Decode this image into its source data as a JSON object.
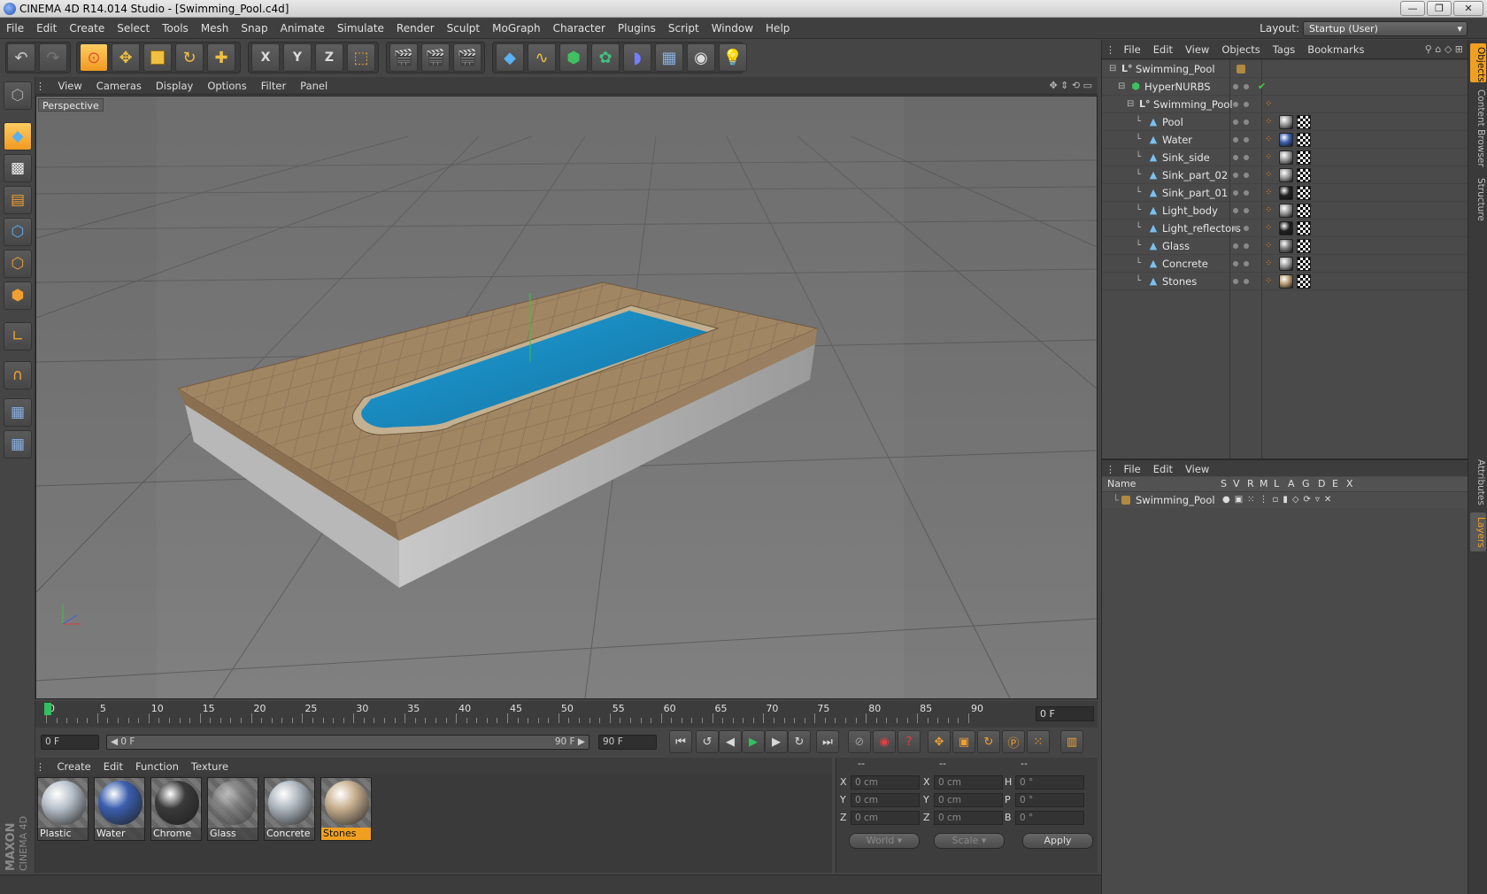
{
  "window": {
    "title": "CINEMA 4D R14.014 Studio - [Swimming_Pool.c4d]",
    "min_glyph": "—",
    "max_glyph": "❐",
    "close_glyph": "✕"
  },
  "menubar": {
    "items": [
      "File",
      "Edit",
      "Create",
      "Select",
      "Tools",
      "Mesh",
      "Snap",
      "Animate",
      "Simulate",
      "Render",
      "Sculpt",
      "MoGraph",
      "Character",
      "Plugins",
      "Script",
      "Window",
      "Help"
    ],
    "layout_label": "Layout:",
    "layout_value": "Startup (User)"
  },
  "toolbar": {
    "undo_glyph": "↶",
    "redo_glyph": "↷",
    "axis_x": "X",
    "axis_y": "Y",
    "axis_z": "Z"
  },
  "viewport": {
    "menu": [
      "View",
      "Cameras",
      "Display",
      "Options",
      "Filter",
      "Panel"
    ],
    "label": "Perspective"
  },
  "timeline": {
    "ticks": [
      "0",
      "5",
      "10",
      "15",
      "20",
      "25",
      "30",
      "35",
      "40",
      "45",
      "50",
      "55",
      "60",
      "65",
      "70",
      "75",
      "80",
      "85",
      "90"
    ],
    "current_frame": "0 F"
  },
  "transport": {
    "start_field": "0 F",
    "range_start": "◀ 0 F",
    "range_end": "90 F ▶",
    "end_field": "90 F"
  },
  "materials": {
    "menu": [
      "Create",
      "Edit",
      "Function",
      "Texture"
    ],
    "items": [
      {
        "name": "Plastic",
        "color": "#b9c2cc"
      },
      {
        "name": "Water",
        "color": "#3b5fae"
      },
      {
        "name": "Chrome",
        "color": "#3a3a3a"
      },
      {
        "name": "Glass",
        "color": "#8a8a8a"
      },
      {
        "name": "Concrete",
        "color": "#b0b8c0"
      },
      {
        "name": "Stones",
        "color": "#c8b090"
      }
    ],
    "selected": "Stones"
  },
  "coordinates": {
    "header": [
      "--",
      "--",
      "--"
    ],
    "rows": [
      {
        "l1": "X",
        "v1": "0 cm",
        "l2": "X",
        "v2": "0 cm",
        "l3": "H",
        "v3": "0 °"
      },
      {
        "l1": "Y",
        "v1": "0 cm",
        "l2": "Y",
        "v2": "0 cm",
        "l3": "P",
        "v3": "0 °"
      },
      {
        "l1": "Z",
        "v1": "0 cm",
        "l2": "Z",
        "v2": "0 cm",
        "l3": "B",
        "v3": "0 °"
      }
    ],
    "world": "World",
    "scale": "Scale",
    "apply": "Apply"
  },
  "objects": {
    "menu": [
      "File",
      "Edit",
      "View",
      "Objects",
      "Tags",
      "Bookmarks"
    ],
    "tree": [
      {
        "name": "Swimming_Pool",
        "indent": 0,
        "icon": "null-icon",
        "tags": "none"
      },
      {
        "name": "HyperNURBS",
        "indent": 1,
        "icon": "hypernurbs-icon",
        "tags": "check"
      },
      {
        "name": "Swimming_Pool",
        "indent": 2,
        "icon": "null-icon",
        "tags": "phong"
      },
      {
        "name": "Pool",
        "indent": 3,
        "icon": "polygon-icon",
        "tags": "mat",
        "mat": "#9a9a9a"
      },
      {
        "name": "Water",
        "indent": 3,
        "icon": "polygon-icon",
        "tags": "mat",
        "mat": "#3b5fae"
      },
      {
        "name": "Sink_side",
        "indent": 3,
        "icon": "polygon-icon",
        "tags": "mat",
        "mat": "#9a9a9a"
      },
      {
        "name": "Sink_part_02",
        "indent": 3,
        "icon": "polygon-icon",
        "tags": "mat",
        "mat": "#9a9a9a"
      },
      {
        "name": "Sink_part_01",
        "indent": 3,
        "icon": "polygon-icon",
        "tags": "mat",
        "mat": "#202020"
      },
      {
        "name": "Light_body",
        "indent": 3,
        "icon": "polygon-icon",
        "tags": "mat",
        "mat": "#9a9a9a"
      },
      {
        "name": "Light_reflectors",
        "indent": 3,
        "icon": "polygon-icon",
        "tags": "mat",
        "mat": "#202020"
      },
      {
        "name": "Glass",
        "indent": 3,
        "icon": "polygon-icon",
        "tags": "mat",
        "mat": "#777777"
      },
      {
        "name": "Concrete",
        "indent": 3,
        "icon": "polygon-icon",
        "tags": "mat",
        "mat": "#9a9a9a"
      },
      {
        "name": "Stones",
        "indent": 3,
        "icon": "polygon-icon",
        "tags": "mat",
        "mat": "#b89a70"
      }
    ]
  },
  "layers": {
    "menu": [
      "File",
      "Edit",
      "View"
    ],
    "columns": [
      "Name",
      "S",
      "V",
      "R",
      "M",
      "L",
      "A",
      "G",
      "D",
      "E",
      "X"
    ],
    "row_name": "Swimming_Pool"
  },
  "sidetabs": [
    "Objects",
    "Content Browser",
    "Structure",
    "Attributes",
    "Layers"
  ],
  "brand": "MAXON CINEMA 4D",
  "colors": {
    "accent": "#f0a020",
    "water": "#1e8fc8",
    "tile": "#9a8060"
  }
}
